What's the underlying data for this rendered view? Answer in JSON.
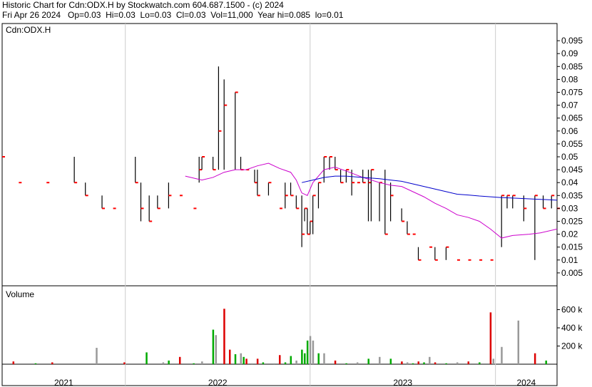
{
  "header": {
    "line1": "Historic Chart for Cdn:ODX.H by Stockwatch.com 604.687.1500 - (c) 2024",
    "line2": "Fri Apr 26 2024   Op=0.03  Hi=0.03  Lo=0.03  Cl=0.03  Vol=11,000  Year hi=0.085  lo=0.01"
  },
  "colors": {
    "price_bar": "#000000",
    "close_tick": "#ff0000",
    "ma_short": "#cc00cc",
    "ma_long": "#0000cc",
    "vol_up": "#00aa00",
    "vol_down": "#dd0000",
    "vol_flat": "#999999",
    "grid": "#cccccc"
  },
  "chart_data": [
    {
      "type": "line",
      "title": "Cdn:ODX.H",
      "ylim": [
        0,
        0.1
      ],
      "y_ticks": [
        "0.005",
        "0.01",
        "0.015",
        "0.02",
        "0.025",
        "0.03",
        "0.035",
        "0.04",
        "0.045",
        "0.05",
        "0.055",
        "0.06",
        "0.065",
        "0.07",
        "0.075",
        "0.08",
        "0.085",
        "0.09",
        "0.095"
      ],
      "x_years": [
        "2021",
        "2022",
        "2023",
        "2024"
      ],
      "series": [
        {
          "kind": "high-low",
          "x": [
            0.0,
            0.03,
            0.08,
            0.13,
            0.15,
            0.18,
            0.2,
            0.24,
            0.25,
            0.265,
            0.28,
            0.3,
            0.32,
            0.345,
            0.355,
            0.36,
            0.38,
            0.39,
            0.4,
            0.42,
            0.43,
            0.44,
            0.455,
            0.46,
            0.48,
            0.5,
            0.51,
            0.52,
            0.53,
            0.54,
            0.545,
            0.55,
            0.555,
            0.56,
            0.57,
            0.58,
            0.59,
            0.6,
            0.61,
            0.62,
            0.63,
            0.64,
            0.65,
            0.66,
            0.665,
            0.68,
            0.69,
            0.7,
            0.72,
            0.73,
            0.74,
            0.75,
            0.77,
            0.78,
            0.8,
            0.82,
            0.84,
            0.86,
            0.88,
            0.9,
            0.91,
            0.92,
            0.94,
            0.96,
            0.975,
            0.99,
            1.0
          ],
          "high": [
            0.05,
            0.04,
            0.04,
            0.05,
            0.04,
            0.035,
            0.03,
            0.05,
            0.04,
            0.035,
            0.035,
            0.04,
            0.035,
            0.03,
            0.05,
            0.05,
            0.05,
            0.085,
            0.08,
            0.075,
            0.05,
            0.045,
            0.045,
            0.045,
            0.04,
            0.03,
            0.04,
            0.04,
            0.035,
            0.035,
            0.03,
            0.03,
            0.025,
            0.035,
            0.04,
            0.05,
            0.05,
            0.05,
            0.045,
            0.045,
            0.045,
            0.04,
            0.045,
            0.045,
            0.045,
            0.04,
            0.045,
            0.04,
            0.03,
            0.025,
            0.02,
            0.015,
            0.015,
            0.015,
            0.015,
            0.01,
            0.01,
            0.01,
            0.01,
            0.035,
            0.035,
            0.035,
            0.035,
            0.035,
            0.035,
            0.035,
            0.03
          ],
          "low": [
            0.05,
            0.04,
            0.04,
            0.04,
            0.035,
            0.03,
            0.03,
            0.04,
            0.025,
            0.025,
            0.03,
            0.03,
            0.035,
            0.03,
            0.04,
            0.045,
            0.045,
            0.045,
            0.045,
            0.045,
            0.045,
            0.045,
            0.04,
            0.035,
            0.035,
            0.03,
            0.03,
            0.035,
            0.03,
            0.015,
            0.025,
            0.02,
            0.02,
            0.02,
            0.03,
            0.04,
            0.045,
            0.045,
            0.04,
            0.04,
            0.035,
            0.04,
            0.04,
            0.025,
            0.025,
            0.025,
            0.02,
            0.025,
            0.025,
            0.02,
            0.02,
            0.01,
            0.015,
            0.01,
            0.01,
            0.01,
            0.01,
            0.01,
            0.01,
            0.015,
            0.03,
            0.03,
            0.025,
            0.01,
            0.03,
            0.03,
            0.03
          ],
          "close": [
            0.05,
            0.04,
            0.04,
            0.04,
            0.035,
            0.03,
            0.03,
            0.04,
            0.03,
            0.025,
            0.03,
            0.035,
            0.035,
            0.03,
            0.045,
            0.05,
            0.045,
            0.06,
            0.07,
            0.075,
            0.045,
            0.045,
            0.04,
            0.035,
            0.04,
            0.03,
            0.035,
            0.035,
            0.03,
            0.02,
            0.03,
            0.02,
            0.025,
            0.035,
            0.04,
            0.05,
            0.05,
            0.045,
            0.04,
            0.045,
            0.04,
            0.04,
            0.04,
            0.04,
            0.045,
            0.04,
            0.02,
            0.035,
            0.025,
            0.02,
            0.02,
            0.01,
            0.015,
            0.01,
            0.015,
            0.01,
            0.01,
            0.01,
            0.01,
            0.035,
            0.035,
            0.035,
            0.03,
            0.035,
            0.03,
            0.035,
            0.03
          ]
        },
        {
          "kind": "ma-short",
          "x": [
            0.33,
            0.36,
            0.38,
            0.4,
            0.42,
            0.44,
            0.46,
            0.48,
            0.5,
            0.52,
            0.53,
            0.54,
            0.55,
            0.56,
            0.58,
            0.6,
            0.62,
            0.65,
            0.68,
            0.7,
            0.72,
            0.74,
            0.76,
            0.78,
            0.8,
            0.82,
            0.84,
            0.86,
            0.88,
            0.9,
            0.92,
            0.95,
            0.97,
            1.0
          ],
          "values": [
            0.0425,
            0.041,
            0.042,
            0.044,
            0.045,
            0.045,
            0.0465,
            0.0475,
            0.0455,
            0.044,
            0.041,
            0.036,
            0.035,
            0.04,
            0.045,
            0.046,
            0.0445,
            0.042,
            0.04,
            0.039,
            0.0385,
            0.0365,
            0.0345,
            0.032,
            0.03,
            0.0275,
            0.0265,
            0.025,
            0.022,
            0.0185,
            0.0195,
            0.02,
            0.0205,
            0.022
          ]
        },
        {
          "kind": "ma-long",
          "x": [
            0.54,
            0.56,
            0.58,
            0.6,
            0.62,
            0.65,
            0.68,
            0.7,
            0.72,
            0.74,
            0.76,
            0.78,
            0.8,
            0.82,
            0.84,
            0.86,
            0.88,
            0.9,
            0.92,
            0.95,
            0.97,
            1.0
          ],
          "values": [
            0.04,
            0.041,
            0.042,
            0.0425,
            0.0425,
            0.042,
            0.0415,
            0.041,
            0.0405,
            0.0395,
            0.0385,
            0.0375,
            0.0365,
            0.0355,
            0.0352,
            0.0348,
            0.0345,
            0.0342,
            0.034,
            0.0337,
            0.0335,
            0.0332
          ]
        }
      ]
    },
    {
      "type": "bar",
      "title": "Volume",
      "ylim": [
        0,
        800000
      ],
      "y_ticks": [
        "200 k",
        "400 k",
        "600 k"
      ],
      "x": [
        0.02,
        0.06,
        0.09,
        0.17,
        0.22,
        0.26,
        0.29,
        0.3,
        0.32,
        0.345,
        0.36,
        0.38,
        0.385,
        0.4,
        0.41,
        0.42,
        0.43,
        0.435,
        0.44,
        0.45,
        0.46,
        0.47,
        0.49,
        0.5,
        0.51,
        0.52,
        0.53,
        0.54,
        0.545,
        0.55,
        0.555,
        0.56,
        0.57,
        0.58,
        0.6,
        0.62,
        0.64,
        0.66,
        0.68,
        0.7,
        0.72,
        0.73,
        0.74,
        0.75,
        0.76,
        0.77,
        0.78,
        0.8,
        0.82,
        0.84,
        0.86,
        0.88,
        0.885,
        0.9,
        0.93,
        0.96,
        0.98
      ],
      "values": [
        30000,
        10000,
        20000,
        180000,
        20000,
        130000,
        20000,
        40000,
        80000,
        10000,
        30000,
        380000,
        320000,
        610000,
        160000,
        110000,
        120000,
        80000,
        60000,
        10000,
        60000,
        20000,
        10000,
        100000,
        20000,
        90000,
        40000,
        160000,
        120000,
        260000,
        310000,
        260000,
        120000,
        120000,
        40000,
        10000,
        20000,
        60000,
        80000,
        60000,
        30000,
        20000,
        10000,
        30000,
        20000,
        80000,
        20000,
        10000,
        20000,
        30000,
        20000,
        570000,
        60000,
        190000,
        480000,
        120000,
        40000
      ],
      "colors": [
        "vol_down",
        "vol_up",
        "vol_down",
        "vol_flat",
        "vol_down",
        "vol_up",
        "vol_flat",
        "vol_up",
        "vol_down",
        "vol_up",
        "vol_flat",
        "vol_up",
        "vol_flat",
        "vol_down",
        "vol_down",
        "vol_up",
        "vol_flat",
        "vol_up",
        "vol_down",
        "vol_flat",
        "vol_down",
        "vol_up",
        "vol_flat",
        "vol_down",
        "vol_up",
        "vol_up",
        "vol_flat",
        "vol_up",
        "vol_up",
        "vol_up",
        "vol_flat",
        "vol_flat",
        "vol_up",
        "vol_flat",
        "vol_down",
        "vol_up",
        "vol_flat",
        "vol_up",
        "vol_flat",
        "vol_up",
        "vol_down",
        "vol_flat",
        "vol_up",
        "vol_down",
        "vol_up",
        "vol_flat",
        "vol_down",
        "vol_up",
        "vol_flat",
        "vol_down",
        "vol_up",
        "vol_down",
        "vol_flat",
        "vol_flat",
        "vol_flat",
        "vol_down",
        "vol_up"
      ]
    }
  ]
}
